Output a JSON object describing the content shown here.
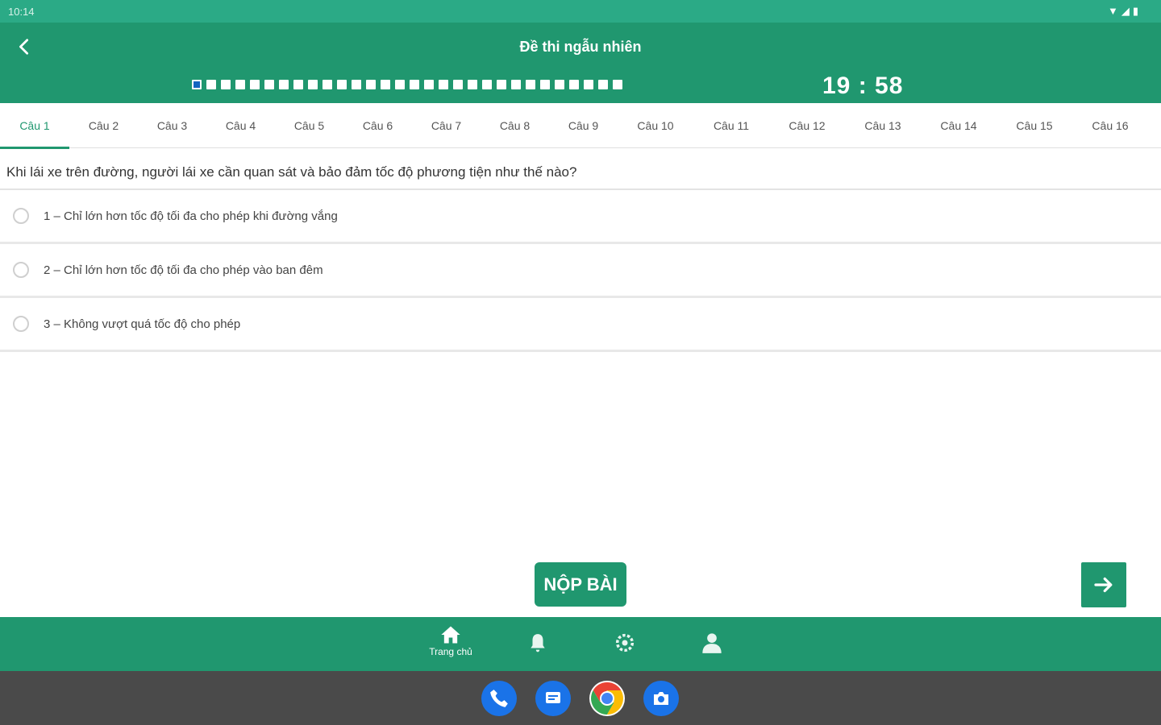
{
  "status_bar": {
    "time": "10:14"
  },
  "header": {
    "title": "Đề thi ngẫu nhiên",
    "timer": "19 : 58",
    "progress_total": 30,
    "progress_current": 1
  },
  "tabs": [
    "Câu 1",
    "Câu 2",
    "Câu 3",
    "Câu 4",
    "Câu 5",
    "Câu 6",
    "Câu 7",
    "Câu 8",
    "Câu 9",
    "Câu 10",
    "Câu 11",
    "Câu 12",
    "Câu 13",
    "Câu 14",
    "Câu 15",
    "Câu 16"
  ],
  "active_tab": 0,
  "question": {
    "text": "Khi lái xe trên đường, người lái xe cần quan sát và bảo đảm tốc độ phương tiện như thế nào?",
    "answers": [
      "1 – Chỉ lớn hơn tốc độ tối đa cho phép khi đường vắng",
      "2 – Chỉ lớn hơn tốc độ tối đa cho phép vào ban đêm",
      "3 – Không vượt quá tốc độ cho phép"
    ]
  },
  "actions": {
    "submit_label": "NỘP BÀI"
  },
  "bottom_nav": {
    "home_label": "Trang chủ"
  },
  "colors": {
    "primary": "#20976f",
    "status": "#2baa86",
    "system_bar": "#4a4a4a"
  }
}
